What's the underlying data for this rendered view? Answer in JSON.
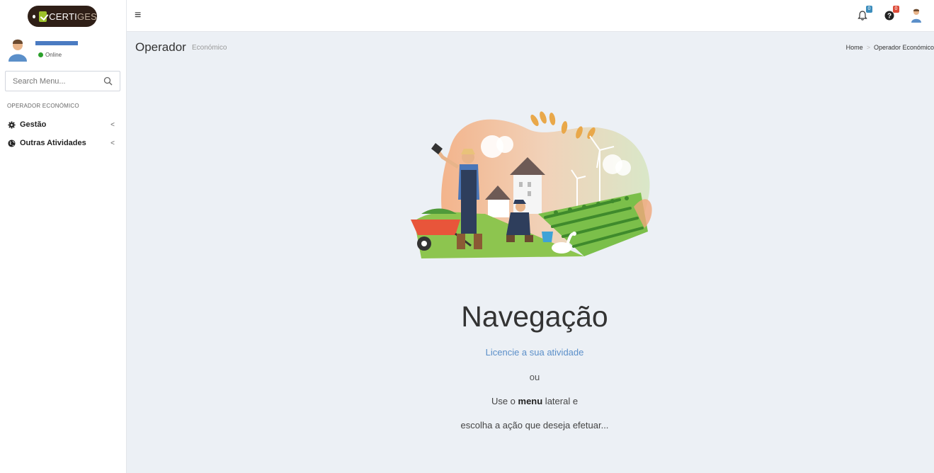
{
  "brand": {
    "logo_text_main": "CERTI",
    "logo_text_faded": "GES"
  },
  "header": {
    "notifications_badge": "0",
    "help_badge": "0"
  },
  "sidebar": {
    "user_status": "Online",
    "search_placeholder": "Search Menu...",
    "section_header": "OPERADOR ECONÓMICO",
    "items": [
      {
        "label": "Gestão",
        "icon": "gear-icon"
      },
      {
        "label": "Outras Atividades",
        "icon": "globe-icon"
      }
    ]
  },
  "content": {
    "title": "Operador",
    "subtitle": "Económico",
    "breadcrumb": [
      "Home",
      "Operador Económico"
    ]
  },
  "navigation": {
    "title": "Navegação",
    "link": "Licencie a sua atividade",
    "or": "ou",
    "line1_prefix": "Use o ",
    "line1_bold": "menu",
    "line1_suffix": " lateral e",
    "line2": "escolha a ação que deseja efetuar..."
  },
  "colors": {
    "accent": "#5b8fc9",
    "logo_bg": "#2f1f17",
    "logo_green": "#9cc12a"
  }
}
